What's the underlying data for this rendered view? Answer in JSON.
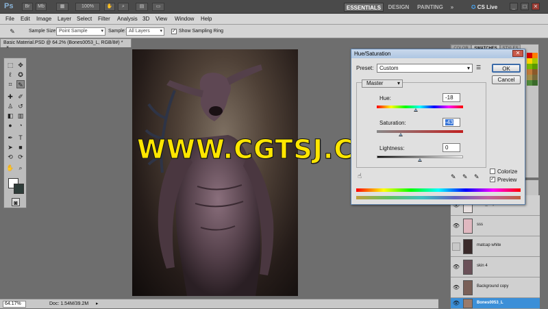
{
  "app": {
    "logo": "Ps",
    "zoom_level": "100%",
    "workspaces": [
      "ESSENTIALS",
      "DESIGN",
      "PAINTING"
    ],
    "workspace_more": "»",
    "cs_live": "CS Live",
    "window_controls": [
      "_",
      "□",
      "✕"
    ]
  },
  "menu": [
    "File",
    "Edit",
    "Image",
    "Layer",
    "Select",
    "Filter",
    "Analysis",
    "3D",
    "View",
    "Window",
    "Help"
  ],
  "options": {
    "sample_size_label": "Sample Size:",
    "sample_size_value": "Point Sample",
    "sample_label": "Sample:",
    "sample_value": "All Layers",
    "show_ring_label": "Show Sampling Ring",
    "show_ring_checked": true
  },
  "document": {
    "tab_title": "Basic Material.PSD @ 64.2% (Bones0053_L, RGB/8#) *",
    "tab_close": "×"
  },
  "statusbar": {
    "zoom": "64.17%",
    "doc_info": "Doc: 1.54M/39.2M"
  },
  "dialog": {
    "title": "Hue/Saturation",
    "close": "✕",
    "preset_label": "Preset:",
    "preset_value": "Custom",
    "channel": "Master",
    "hue_label": "Hue:",
    "hue_value": "-18",
    "hue_pos": 0.45,
    "saturation_label": "Saturation:",
    "saturation_value": "-43",
    "saturation_pos": 0.28,
    "lightness_label": "Lightness:",
    "lightness_value": "0",
    "lightness_pos": 0.5,
    "ok": "OK",
    "cancel": "Cancel",
    "colorize_label": "Colorize",
    "colorize_checked": false,
    "preview_label": "Preview",
    "preview_checked": true
  },
  "panels": {
    "tabs": [
      "COLOR",
      "SWATCHES",
      "STYLES"
    ]
  },
  "layers": [
    {
      "name": "BPR_Depth",
      "visible": true
    },
    {
      "name": "sss",
      "visible": true
    },
    {
      "name": "matcap white",
      "visible": false
    },
    {
      "name": "skin 4",
      "visible": true
    },
    {
      "name": "Background copy",
      "visible": true
    },
    {
      "name": "Bones0053_L",
      "visible": true,
      "selected": true
    }
  ],
  "watermark": "WWW.CGTSJ.COM"
}
